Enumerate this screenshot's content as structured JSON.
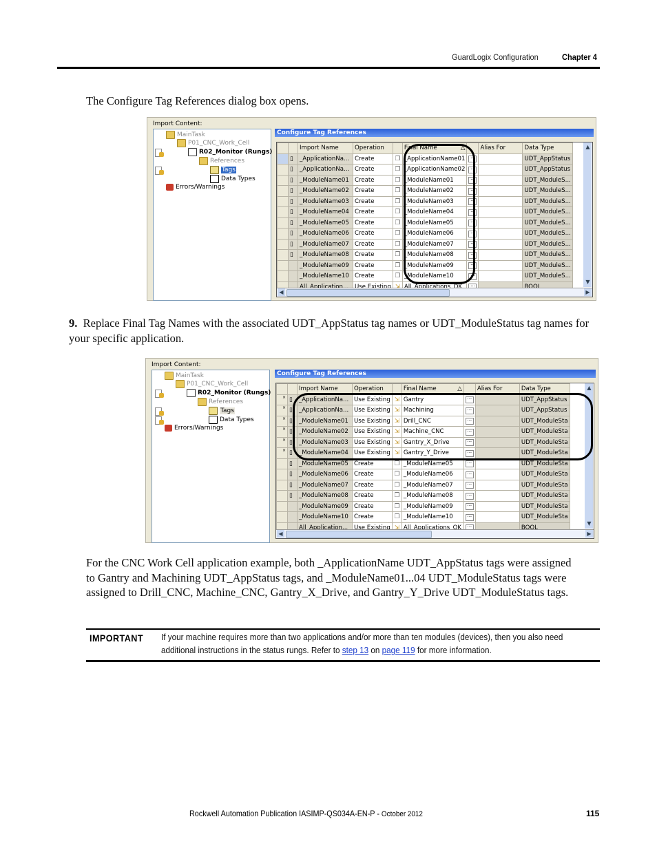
{
  "header": {
    "section": "GuardLogix Configuration",
    "chapter": "Chapter 4"
  },
  "intro_text": "The Configure Tag References dialog box opens.",
  "step": {
    "number": "9.",
    "text": "Replace Final Tag Names with the associated UDT_AppStatus tag names or UDT_ModuleStatus tag names for your specific application."
  },
  "explanation": "For the CNC Work Cell application example, both _ApplicationName UDT_AppStatus tags were assigned to Gantry and Machining UDT_AppStatus tags, and _ModuleName01...04 UDT_ModuleStatus tags were assigned to Drill_CNC, Machine_CNC, Gantry_X_Drive, and Gantry_Y_Drive UDT_ModuleStatus tags.",
  "dialog1": {
    "import_content_label": "Import Content:",
    "title": "Configure Tag References",
    "tree": [
      "MainTask",
      "P01_CNC_Work_Cell",
      "R02_Monitor (Rungs)",
      "References",
      "Tags",
      "Data Types",
      "Errors/Warnings"
    ],
    "columns": [
      "Import Name",
      "Operation",
      "Final Name",
      "Alias For",
      "Data Type"
    ],
    "rows": [
      {
        "import": "_ApplicationNa...",
        "op": "Create",
        "final": "_ApplicationName01",
        "alias": "",
        "type": "UDT_AppStatus"
      },
      {
        "import": "_ApplicationNa...",
        "op": "Create",
        "final": "_ApplicationName02",
        "alias": "",
        "type": "UDT_AppStatus"
      },
      {
        "import": "_ModuleName01",
        "op": "Create",
        "final": "_ModuleName01",
        "alias": "",
        "type": "UDT_ModuleS..."
      },
      {
        "import": "_ModuleName02",
        "op": "Create",
        "final": "_ModuleName02",
        "alias": "",
        "type": "UDT_ModuleS..."
      },
      {
        "import": "_ModuleName03",
        "op": "Create",
        "final": "_ModuleName03",
        "alias": "",
        "type": "UDT_ModuleS..."
      },
      {
        "import": "_ModuleName04",
        "op": "Create",
        "final": "_ModuleName04",
        "alias": "",
        "type": "UDT_ModuleS..."
      },
      {
        "import": "_ModuleName05",
        "op": "Create",
        "final": "_ModuleName05",
        "alias": "",
        "type": "UDT_ModuleS..."
      },
      {
        "import": "_ModuleName06",
        "op": "Create",
        "final": "_ModuleName06",
        "alias": "",
        "type": "UDT_ModuleS..."
      },
      {
        "import": "_ModuleName07",
        "op": "Create",
        "final": "_ModuleName07",
        "alias": "",
        "type": "UDT_ModuleS..."
      },
      {
        "import": "_ModuleName08",
        "op": "Create",
        "final": "_ModuleName08",
        "alias": "",
        "type": "UDT_ModuleS..."
      },
      {
        "import": "_ModuleName09",
        "op": "Create",
        "final": "_ModuleName09",
        "alias": "",
        "type": "UDT_ModuleS..."
      },
      {
        "import": "_ModuleName10",
        "op": "Create",
        "final": "_ModuleName10",
        "alias": "",
        "type": "UDT_ModuleS..."
      },
      {
        "import": "All_Application...",
        "op": "Use Existing",
        "final": "All_Applications_OK",
        "alias": "",
        "type": "BOOL"
      }
    ]
  },
  "dialog2": {
    "import_content_label": "Import Content:",
    "title": "Configure Tag References",
    "tree": [
      "MainTask",
      "P01_CNC_Work_Cell",
      "R02_Monitor (Rungs)",
      "References",
      "Tags",
      "Data Types",
      "Errors/Warnings"
    ],
    "columns": [
      "Import Name",
      "Operation",
      "Final Name",
      "Alias For",
      "Data Type"
    ],
    "rows": [
      {
        "import": "_ApplicationNa...",
        "op": "Use Existing",
        "final": "Gantry",
        "alias": "",
        "type": "UDT_AppStatus"
      },
      {
        "import": "_ApplicationNa...",
        "op": "Use Existing",
        "final": "Machining",
        "alias": "",
        "type": "UDT_AppStatus"
      },
      {
        "import": "_ModuleName01",
        "op": "Use Existing",
        "final": "Drill_CNC",
        "alias": "",
        "type": "UDT_ModuleSta"
      },
      {
        "import": "_ModuleName02",
        "op": "Use Existing",
        "final": "Machine_CNC",
        "alias": "",
        "type": "UDT_ModuleSta"
      },
      {
        "import": "_ModuleName03",
        "op": "Use Existing",
        "final": "Gantry_X_Drive",
        "alias": "",
        "type": "UDT_ModuleSta"
      },
      {
        "import": "_ModuleName04",
        "op": "Use Existing",
        "final": "Gantry_Y_Drive",
        "alias": "",
        "type": "UDT_ModuleSta"
      },
      {
        "import": "_ModuleName05",
        "op": "Create",
        "final": "_ModuleName05",
        "alias": "",
        "type": "UDT_ModuleSta"
      },
      {
        "import": "_ModuleName06",
        "op": "Create",
        "final": "_ModuleName06",
        "alias": "",
        "type": "UDT_ModuleSta"
      },
      {
        "import": "_ModuleName07",
        "op": "Create",
        "final": "_ModuleName07",
        "alias": "",
        "type": "UDT_ModuleSta"
      },
      {
        "import": "_ModuleName08",
        "op": "Create",
        "final": "_ModuleName08",
        "alias": "",
        "type": "UDT_ModuleSta"
      },
      {
        "import": "_ModuleName09",
        "op": "Create",
        "final": "_ModuleName09",
        "alias": "",
        "type": "UDT_ModuleSta"
      },
      {
        "import": "_ModuleName10",
        "op": "Create",
        "final": "_ModuleName10",
        "alias": "",
        "type": "UDT_ModuleSta"
      },
      {
        "import": "All_Application...",
        "op": "Use Existing",
        "final": "All_Applications_OK",
        "alias": "",
        "type": "BOOL"
      }
    ]
  },
  "important": {
    "label": "IMPORTANT",
    "text_before": "If your machine requires more than two applications and/or more than ten modules (devices), then you also need additional instructions in the status rungs. Refer to ",
    "link1": "step 13",
    "text_mid": " on ",
    "link2": "page 119",
    "text_after": " for more information."
  },
  "footer": {
    "publication": "Rockwell Automation Publication IASIMP-QS034A-EN-P - ",
    "date": "October 2012",
    "page": "115"
  },
  "colors": {
    "title_bar": "#2a5fd8",
    "link": "#1a3ccc",
    "selection": "#316ac5"
  }
}
